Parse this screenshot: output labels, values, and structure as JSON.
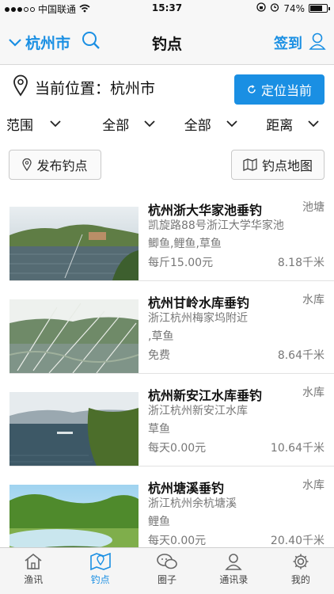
{
  "status_bar": {
    "carrier": "中国联通",
    "time": "15:37",
    "battery": "74%",
    "battery_level": 0.74
  },
  "nav": {
    "city": "杭州市",
    "title": "钓点",
    "checkin": "签到"
  },
  "location": {
    "label": "当前位置：",
    "city": "杭州市",
    "locate_button": "定位当前"
  },
  "filters": [
    {
      "label": "范围"
    },
    {
      "label": "全部"
    },
    {
      "label": "全部"
    },
    {
      "label": "距离"
    }
  ],
  "actions": {
    "publish": "发布钓点",
    "map": "钓点地图"
  },
  "spots": [
    {
      "name": "杭州浙大华家池垂钓",
      "type": "池塘",
      "address": "凯旋路88号浙江大学华家池",
      "fish": "鲫鱼,鲤鱼,草鱼",
      "price": "每斤15.00元",
      "distance": "8.18千米"
    },
    {
      "name": "杭州甘岭水库垂钓",
      "type": "水库",
      "address": "浙江杭州梅家坞附近",
      "fish": ",草鱼",
      "price": "免费",
      "distance": "8.64千米"
    },
    {
      "name": "杭州新安江水库垂钓",
      "type": "水库",
      "address": "浙江杭州新安江水库",
      "fish": "草鱼",
      "price": "每天0.00元",
      "distance": "10.64千米"
    },
    {
      "name": "杭州塘溪垂钓",
      "type": "水库",
      "address": "浙江杭州余杭塘溪",
      "fish": "鲤鱼",
      "price": "每天0.00元",
      "distance": "20.40千米"
    }
  ],
  "tabs": [
    {
      "label": "渔讯",
      "icon": "home-icon"
    },
    {
      "label": "钓点",
      "icon": "map-pin-icon"
    },
    {
      "label": "圈子",
      "icon": "chat-icon"
    },
    {
      "label": "通讯录",
      "icon": "contact-icon"
    },
    {
      "label": "我的",
      "icon": "gear-icon"
    }
  ],
  "colors": {
    "accent": "#1a8fe3"
  }
}
